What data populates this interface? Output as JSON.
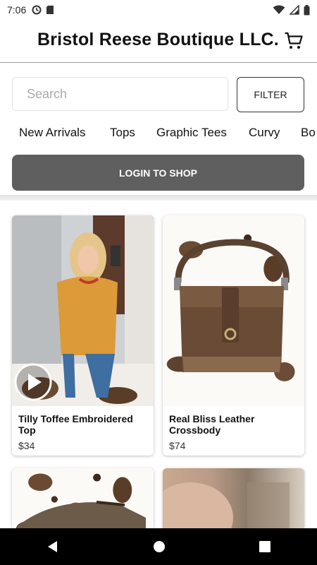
{
  "status_bar": {
    "time": "7:06"
  },
  "header": {
    "brand": "Bristol Reese Boutique LLC."
  },
  "search": {
    "placeholder": "Search"
  },
  "filter": {
    "label": "FILTER"
  },
  "categories": [
    "New Arrivals",
    "Tops",
    "Graphic Tees",
    "Curvy",
    "Bo"
  ],
  "login": {
    "label": "LOGIN TO SHOP"
  },
  "products": [
    {
      "title": "Tilly Toffee Embroidered Top",
      "price": "$34"
    },
    {
      "title": "Real Bliss Leather Crossbody",
      "price": "$74"
    }
  ],
  "colors": {
    "login_bg": "#5f5f5f",
    "navbar_bg": "#000000"
  },
  "icons": [
    "data-saver-icon",
    "sd-card-icon",
    "wifi-icon",
    "signal-icon",
    "battery-icon",
    "cart-icon",
    "play-icon",
    "back-icon",
    "home-icon",
    "recents-icon"
  ]
}
